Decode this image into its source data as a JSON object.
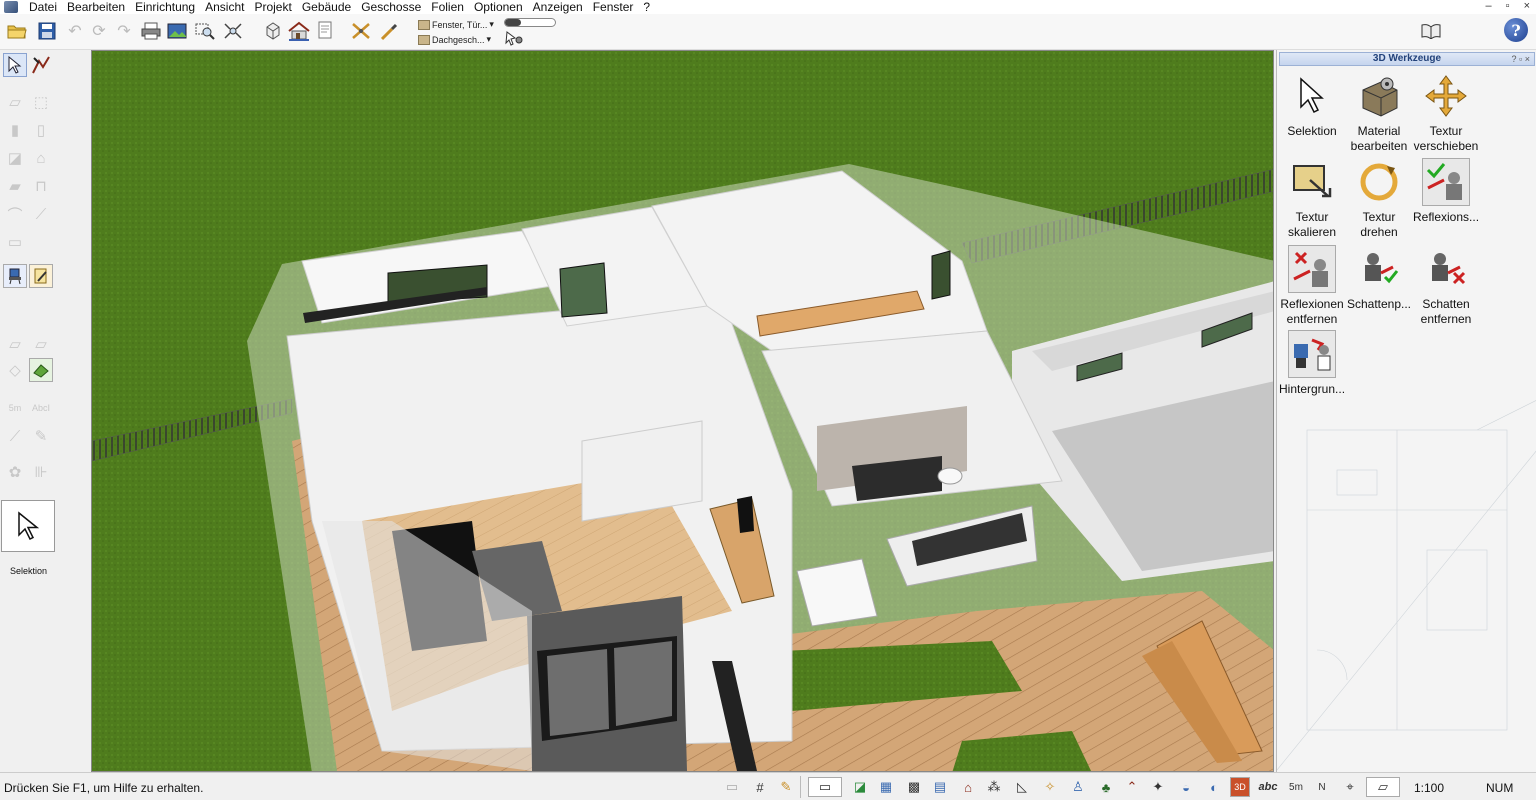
{
  "menubar": {
    "items": [
      "Datei",
      "Bearbeiten",
      "Einrichtung",
      "Ansicht",
      "Projekt",
      "Gebäude",
      "Geschosse",
      "Folien",
      "Optionen",
      "Anzeigen",
      "Fenster",
      "?"
    ]
  },
  "window_controls": [
    "–",
    "▫",
    "×"
  ],
  "toolbar": {
    "combo_top": "Fenster, Tür...",
    "combo_bottom": "Dachgesch...",
    "combo_arrow": "▾",
    "help_label": "?"
  },
  "left_toolbar": {
    "selection_label": "Selektion",
    "text_tool_a": "5m",
    "text_tool_b": "AbcI"
  },
  "right_panel": {
    "title": "3D Werkzeuge",
    "pin_label": "? ▫ ×",
    "tools": [
      {
        "label": "Selektion",
        "icon": "cursor-icon"
      },
      {
        "label": "Material bearbeiten",
        "icon": "material-gear-icon"
      },
      {
        "label": "Textur verschieben",
        "icon": "move-arrows-icon"
      },
      {
        "label": "Textur skalieren",
        "icon": "scale-texture-icon"
      },
      {
        "label": "Textur drehen",
        "icon": "rotate-texture-icon"
      },
      {
        "label": "Reflexions...",
        "icon": "reflection-add-icon"
      },
      {
        "label": "Reflexionen entfernen",
        "icon": "reflection-remove-icon"
      },
      {
        "label": "Schattenp...",
        "icon": "shadow-add-icon"
      },
      {
        "label": "Schatten entfernen",
        "icon": "shadow-remove-icon"
      },
      {
        "label": "Hintergrun...",
        "icon": "background-icon"
      }
    ]
  },
  "statusbar": {
    "hint": "Drücken Sie F1, um Hilfe zu erhalten.",
    "scale": "1:100",
    "num": "NUM",
    "abc": "abc",
    "five_m": "5m",
    "north": "N",
    "three_d": "3D"
  },
  "colors": {
    "grass": "#4d7a1c",
    "wood_deck": "#c99a6a",
    "wall": "#f2f2f2",
    "accent_blue": "#2b4a8a"
  }
}
